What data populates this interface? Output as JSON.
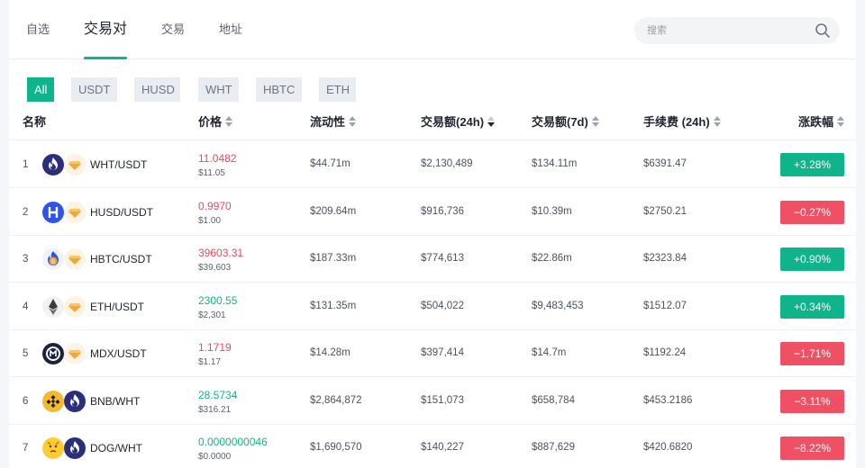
{
  "tabs": [
    {
      "label": "自选",
      "active": false
    },
    {
      "label": "交易对",
      "active": true
    },
    {
      "label": "交易",
      "active": false
    },
    {
      "label": "地址",
      "active": false
    }
  ],
  "search": {
    "placeholder": "搜索",
    "icon": "search-icon"
  },
  "filters": [
    {
      "label": "All",
      "active": true
    },
    {
      "label": "USDT",
      "active": false
    },
    {
      "label": "HUSD",
      "active": false
    },
    {
      "label": "WHT",
      "active": false
    },
    {
      "label": "HBTC",
      "active": false
    },
    {
      "label": "ETH",
      "active": false
    }
  ],
  "columns": {
    "name": "名称",
    "price": "价格",
    "liquidity": "流动性",
    "volume24h": "交易额(24h)",
    "volume7d": "交易额(7d)",
    "fee24h": "手续费 (24h)",
    "change": "涨跌幅"
  },
  "colors": {
    "accent": "#10b48a",
    "up": "#10b48a",
    "down": "#f05064"
  },
  "rows": [
    {
      "index": "1",
      "icons": [
        "wht-token-icon",
        "usdt-token-icon"
      ],
      "pair": "WHT/USDT",
      "price": "11.0482",
      "price_dir": "red",
      "price_usd": "$11.05",
      "liquidity": "$44.71m",
      "volume24h": "$2,130,489",
      "volume7d": "$134.11m",
      "fee24h": "$6391.47",
      "change": "+3.28%",
      "change_dir": "up"
    },
    {
      "index": "2",
      "icons": [
        "husd-token-icon",
        "usdt-token-icon"
      ],
      "pair": "HUSD/USDT",
      "price": "0.9970",
      "price_dir": "red",
      "price_usd": "$1.00",
      "liquidity": "$209.64m",
      "volume24h": "$916,736",
      "volume7d": "$10.39m",
      "fee24h": "$2750.21",
      "change": "−0.27%",
      "change_dir": "dn"
    },
    {
      "index": "3",
      "icons": [
        "hbtc-token-icon",
        "usdt-token-icon"
      ],
      "pair": "HBTC/USDT",
      "price": "39603.31",
      "price_dir": "red",
      "price_usd": "$39,603",
      "liquidity": "$187.33m",
      "volume24h": "$774,613",
      "volume7d": "$22.86m",
      "fee24h": "$2323.84",
      "change": "+0.90%",
      "change_dir": "up"
    },
    {
      "index": "4",
      "icons": [
        "eth-token-icon",
        "usdt-token-icon"
      ],
      "pair": "ETH/USDT",
      "price": "2300.55",
      "price_dir": "green",
      "price_usd": "$2,301",
      "liquidity": "$131.35m",
      "volume24h": "$504,022",
      "volume7d": "$9,483,453",
      "fee24h": "$1512.07",
      "change": "+0.34%",
      "change_dir": "up"
    },
    {
      "index": "5",
      "icons": [
        "mdx-token-icon",
        "usdt-token-icon"
      ],
      "pair": "MDX/USDT",
      "price": "1.1719",
      "price_dir": "red",
      "price_usd": "$1.17",
      "liquidity": "$14.28m",
      "volume24h": "$397,414",
      "volume7d": "$14.7m",
      "fee24h": "$1192.24",
      "change": "−1.71%",
      "change_dir": "dn"
    },
    {
      "index": "6",
      "icons": [
        "bnb-token-icon",
        "wht-token-icon"
      ],
      "pair": "BNB/WHT",
      "price": "28.5734",
      "price_dir": "green",
      "price_usd": "$316.21",
      "liquidity": "$2,864,872",
      "volume24h": "$151,073",
      "volume7d": "$658,784",
      "fee24h": "$453.2186",
      "change": "−3.11%",
      "change_dir": "dn"
    },
    {
      "index": "7",
      "icons": [
        "dog-token-icon",
        "wht-token-icon"
      ],
      "pair": "DOG/WHT",
      "price": "0.0000000046",
      "price_dir": "green",
      "price_usd": "$0.0000",
      "liquidity": "$1,690,570",
      "volume24h": "$140,227",
      "volume7d": "$887,629",
      "fee24h": "$420.6820",
      "change": "−8.22%",
      "change_dir": "dn"
    }
  ]
}
